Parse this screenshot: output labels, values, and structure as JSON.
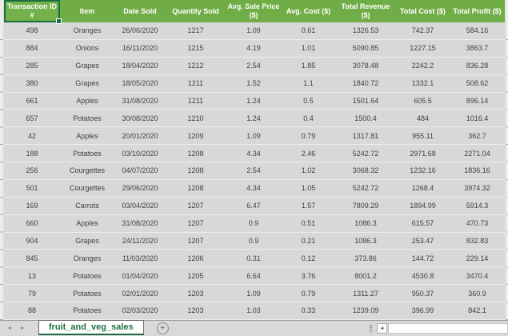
{
  "colors": {
    "header_green": "#71AD47",
    "selection_green": "#1E6C41",
    "tab_text_green": "#1F7244",
    "row_fill": "#D8D8D8",
    "cell_text": "#3F3F3F",
    "tab_bar_bg": "#D9D9D9",
    "grid_line": "#EDEDED"
  },
  "table": {
    "columns": [
      {
        "id": "transaction-id",
        "label": "Transaction ID #",
        "selected": true
      },
      {
        "id": "item",
        "label": "Item",
        "selected": false
      },
      {
        "id": "date-sold",
        "label": "Date Sold",
        "selected": false
      },
      {
        "id": "quantity-sold",
        "label": "Quantity Sold",
        "selected": false
      },
      {
        "id": "avg-sale-price",
        "label": "Avg. Sale Price ($)",
        "selected": false
      },
      {
        "id": "avg-cost",
        "label": "Avg. Cost ($)",
        "selected": false
      },
      {
        "id": "total-revenue",
        "label": "Total Revenue ($)",
        "selected": false
      },
      {
        "id": "total-cost",
        "label": "Total Cost ($)",
        "selected": false
      },
      {
        "id": "total-profit",
        "label": "Total Profit ($)",
        "selected": false
      }
    ],
    "rows": [
      [
        "498",
        "Oranges",
        "26/06/2020",
        "1217",
        "1.09",
        "0.61",
        "1326.53",
        "742.37",
        "584.16"
      ],
      [
        "884",
        "Onions",
        "16/11/2020",
        "1215",
        "4.19",
        "1.01",
        "5090.85",
        "1227.15",
        "3863.7"
      ],
      [
        "285",
        "Grapes",
        "18/04/2020",
        "1212",
        "2.54",
        "1.85",
        "3078.48",
        "2242.2",
        "836.28"
      ],
      [
        "380",
        "Grapes",
        "18/05/2020",
        "1211",
        "1.52",
        "1.1",
        "1840.72",
        "1332.1",
        "508.62"
      ],
      [
        "661",
        "Apples",
        "31/08/2020",
        "1211",
        "1.24",
        "0.5",
        "1501.64",
        "605.5",
        "896.14"
      ],
      [
        "657",
        "Potatoes",
        "30/08/2020",
        "1210",
        "1.24",
        "0.4",
        "1500.4",
        "484",
        "1016.4"
      ],
      [
        "42",
        "Apples",
        "20/01/2020",
        "1209",
        "1.09",
        "0.79",
        "1317.81",
        "955.11",
        "362.7"
      ],
      [
        "188",
        "Potatoes",
        "03/10/2020",
        "1208",
        "4.34",
        "2.46",
        "5242.72",
        "2971.68",
        "2271.04"
      ],
      [
        "256",
        "Courgettes",
        "04/07/2020",
        "1208",
        "2.54",
        "1.02",
        "3068.32",
        "1232.16",
        "1836.16"
      ],
      [
        "501",
        "Courgettes",
        "29/06/2020",
        "1208",
        "4.34",
        "1.05",
        "5242.72",
        "1268.4",
        "3974.32"
      ],
      [
        "169",
        "Carrots",
        "03/04/2020",
        "1207",
        "6.47",
        "1.57",
        "7809.29",
        "1894.99",
        "5914.3"
      ],
      [
        "660",
        "Apples",
        "31/08/2020",
        "1207",
        "0.9",
        "0.51",
        "1086.3",
        "615.57",
        "470.73"
      ],
      [
        "904",
        "Grapes",
        "24/11/2020",
        "1207",
        "0.9",
        "0.21",
        "1086.3",
        "253.47",
        "832.83"
      ],
      [
        "845",
        "Oranges",
        "11/03/2020",
        "1206",
        "0.31",
        "0.12",
        "373.86",
        "144.72",
        "229.14"
      ],
      [
        "13",
        "Potatoes",
        "01/04/2020",
        "1205",
        "6.64",
        "3.76",
        "8001.2",
        "4530.8",
        "3470.4"
      ],
      [
        "79",
        "Potatoes",
        "02/01/2020",
        "1203",
        "1.09",
        "0.79",
        "1311.27",
        "950.37",
        "360.9"
      ],
      [
        "88",
        "Potatoes",
        "02/03/2020",
        "1203",
        "1.03",
        "0.33",
        "1239.09",
        "396.99",
        "842.1"
      ]
    ]
  },
  "sheet_bar": {
    "active_tab": "fruit_and_veg_sales",
    "nav_left_icon": "◄",
    "nav_right_icon": "►",
    "add_sheet_icon": "+",
    "scroll_left_icon": "◄"
  }
}
